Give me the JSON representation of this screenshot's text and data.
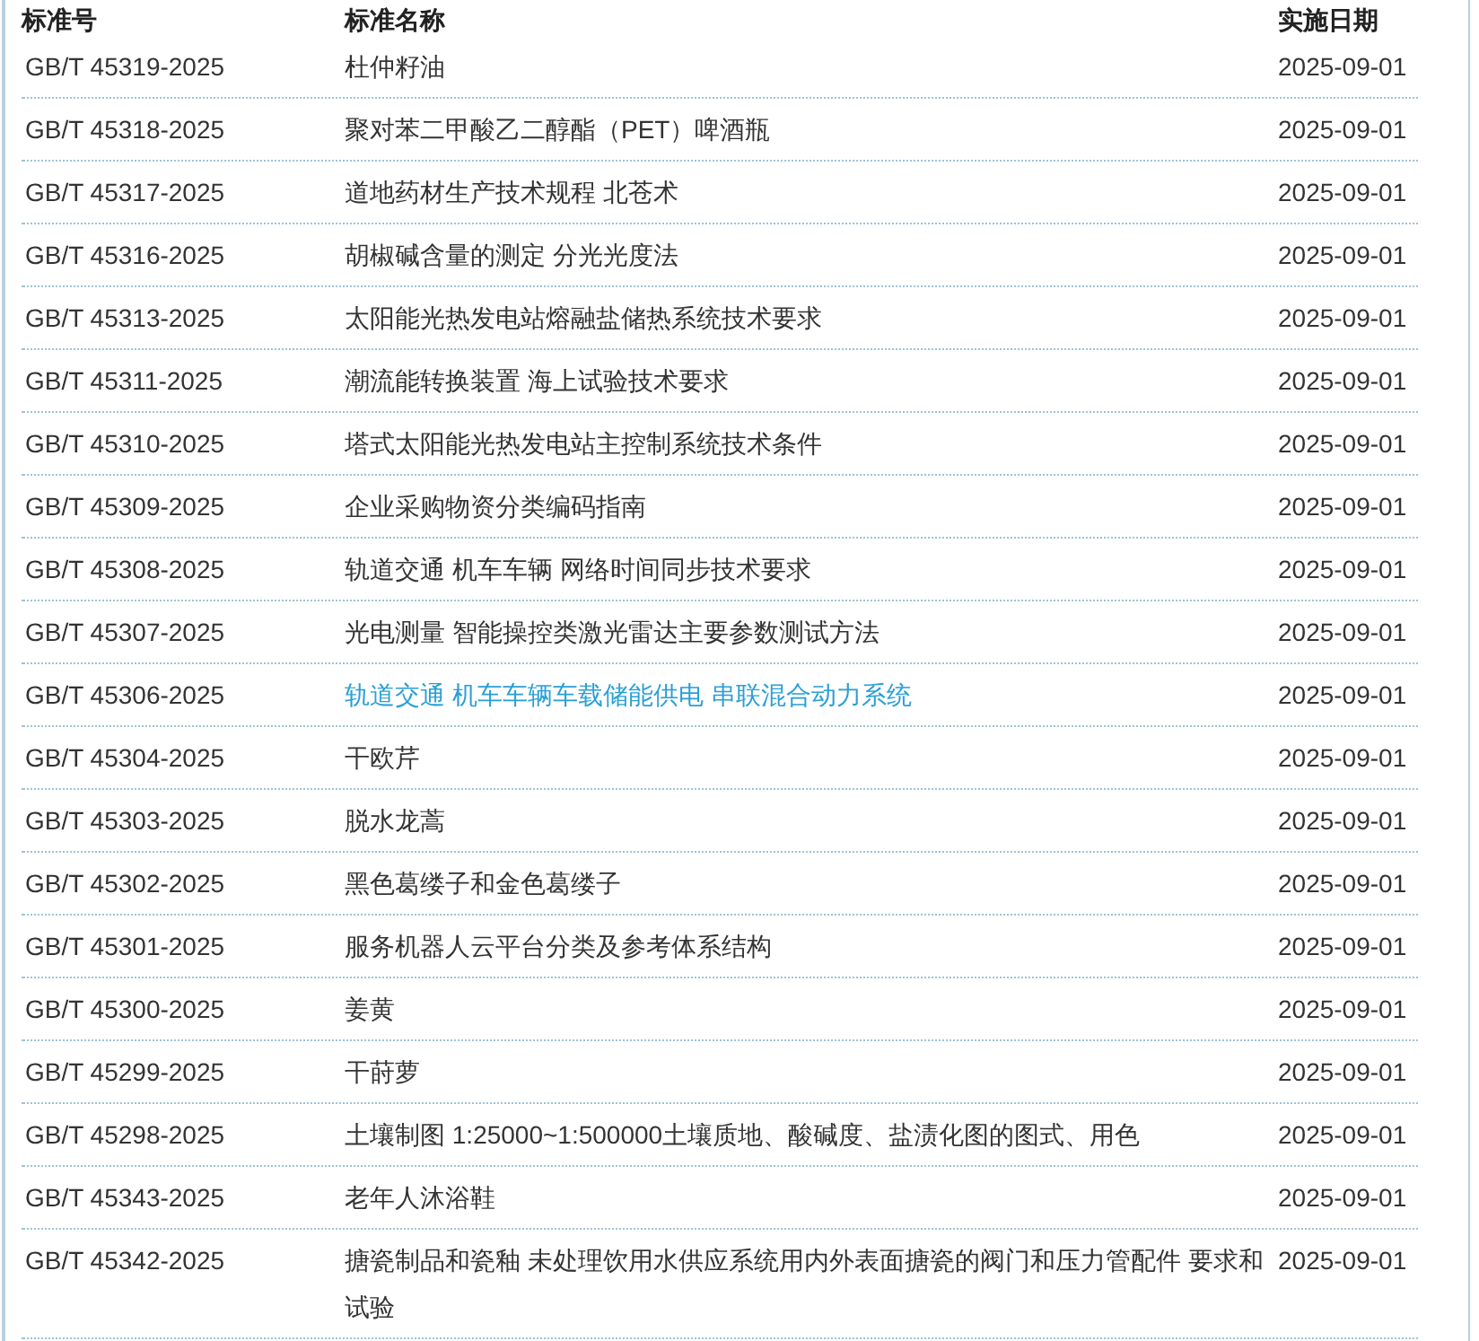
{
  "table": {
    "columns": [
      "标准号",
      "标准名称",
      "实施日期"
    ],
    "rows": [
      {
        "number": "GB/T 45319-2025",
        "name": "杜仲籽油",
        "date": "2025-09-01",
        "highlighted": false
      },
      {
        "number": "GB/T 45318-2025",
        "name": "聚对苯二甲酸乙二醇酯（PET）啤酒瓶",
        "date": "2025-09-01",
        "highlighted": false
      },
      {
        "number": "GB/T 45317-2025",
        "name": "道地药材生产技术规程 北苍术",
        "date": "2025-09-01",
        "highlighted": false
      },
      {
        "number": "GB/T 45316-2025",
        "name": "胡椒碱含量的测定 分光光度法",
        "date": "2025-09-01",
        "highlighted": false
      },
      {
        "number": "GB/T 45313-2025",
        "name": "太阳能光热发电站熔融盐储热系统技术要求",
        "date": "2025-09-01",
        "highlighted": false
      },
      {
        "number": "GB/T 45311-2025",
        "name": "潮流能转换装置 海上试验技术要求",
        "date": "2025-09-01",
        "highlighted": false
      },
      {
        "number": "GB/T 45310-2025",
        "name": "塔式太阳能光热发电站主控制系统技术条件",
        "date": "2025-09-01",
        "highlighted": false
      },
      {
        "number": "GB/T 45309-2025",
        "name": "企业采购物资分类编码指南",
        "date": "2025-09-01",
        "highlighted": false
      },
      {
        "number": "GB/T 45308-2025",
        "name": "轨道交通 机车车辆 网络时间同步技术要求",
        "date": "2025-09-01",
        "highlighted": false
      },
      {
        "number": "GB/T 45307-2025",
        "name": "光电测量 智能操控类激光雷达主要参数测试方法",
        "date": "2025-09-01",
        "highlighted": false
      },
      {
        "number": "GB/T 45306-2025",
        "name": "轨道交通 机车车辆车载储能供电 串联混合动力系统",
        "date": "2025-09-01",
        "highlighted": true
      },
      {
        "number": "GB/T 45304-2025",
        "name": "干欧芹",
        "date": "2025-09-01",
        "highlighted": false
      },
      {
        "number": "GB/T 45303-2025",
        "name": "脱水龙蒿",
        "date": "2025-09-01",
        "highlighted": false
      },
      {
        "number": "GB/T 45302-2025",
        "name": "黑色葛缕子和金色葛缕子",
        "date": "2025-09-01",
        "highlighted": false
      },
      {
        "number": "GB/T 45301-2025",
        "name": "服务机器人云平台分类及参考体系结构",
        "date": "2025-09-01",
        "highlighted": false
      },
      {
        "number": "GB/T 45300-2025",
        "name": "姜黄",
        "date": "2025-09-01",
        "highlighted": false
      },
      {
        "number": "GB/T 45299-2025",
        "name": "干莳萝",
        "date": "2025-09-01",
        "highlighted": false
      },
      {
        "number": "GB/T 45298-2025",
        "name": "土壤制图 1:25000~1:500000土壤质地、酸碱度、盐渍化图的图式、用色",
        "date": "2025-09-01",
        "highlighted": false
      },
      {
        "number": "GB/T 45343-2025",
        "name": "老年人沐浴鞋",
        "date": "2025-09-01",
        "highlighted": false
      },
      {
        "number": "GB/T 45342-2025",
        "name": "搪瓷制品和瓷釉 未处理饮用水供应系统用内外表面搪瓷的阀门和压力管配件 要求和试验",
        "date": "2025-09-01",
        "highlighted": false
      }
    ]
  }
}
